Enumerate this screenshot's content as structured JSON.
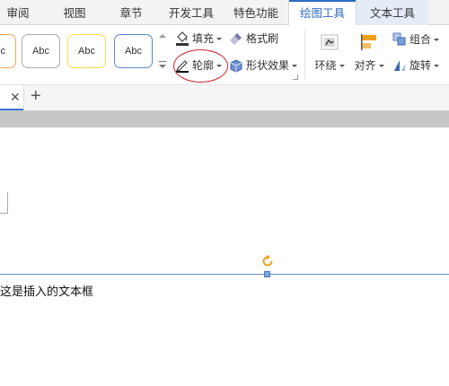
{
  "tabs": [
    {
      "label": "审阅"
    },
    {
      "label": "视图"
    },
    {
      "label": "章节"
    },
    {
      "label": "开发工具"
    },
    {
      "label": "特色功能"
    },
    {
      "label": "绘图工具"
    },
    {
      "label": "文本工具"
    }
  ],
  "ribbon": {
    "style_samples": [
      "Abc",
      "Abc",
      "Abc",
      "Abc"
    ],
    "fill_label": "填充",
    "format_painter_label": "格式刷",
    "outline_label": "轮廓",
    "shape_effects_label": "形状效果",
    "wrap_label": "环绕",
    "align_label": "对齐",
    "group_label": "组合",
    "rotate_label": "旋转"
  },
  "document": {
    "textbox_text": "这是插入的文本框"
  },
  "colors": {
    "accent": "#2f6cc0",
    "highlight_ellipse": "#d1202a",
    "handle": "#7ea6d6",
    "rotate_handle": "#f0a020"
  },
  "icons": {
    "fill": "paint-bucket-icon",
    "format_painter": "brush-icon",
    "outline": "pen-outline-icon",
    "shape_effects": "cube-icon",
    "wrap": "wrap-text-icon",
    "align": "align-icon",
    "group": "group-icon",
    "rotate": "rotate-icon",
    "close": "close-icon",
    "new_tab": "plus-icon"
  }
}
